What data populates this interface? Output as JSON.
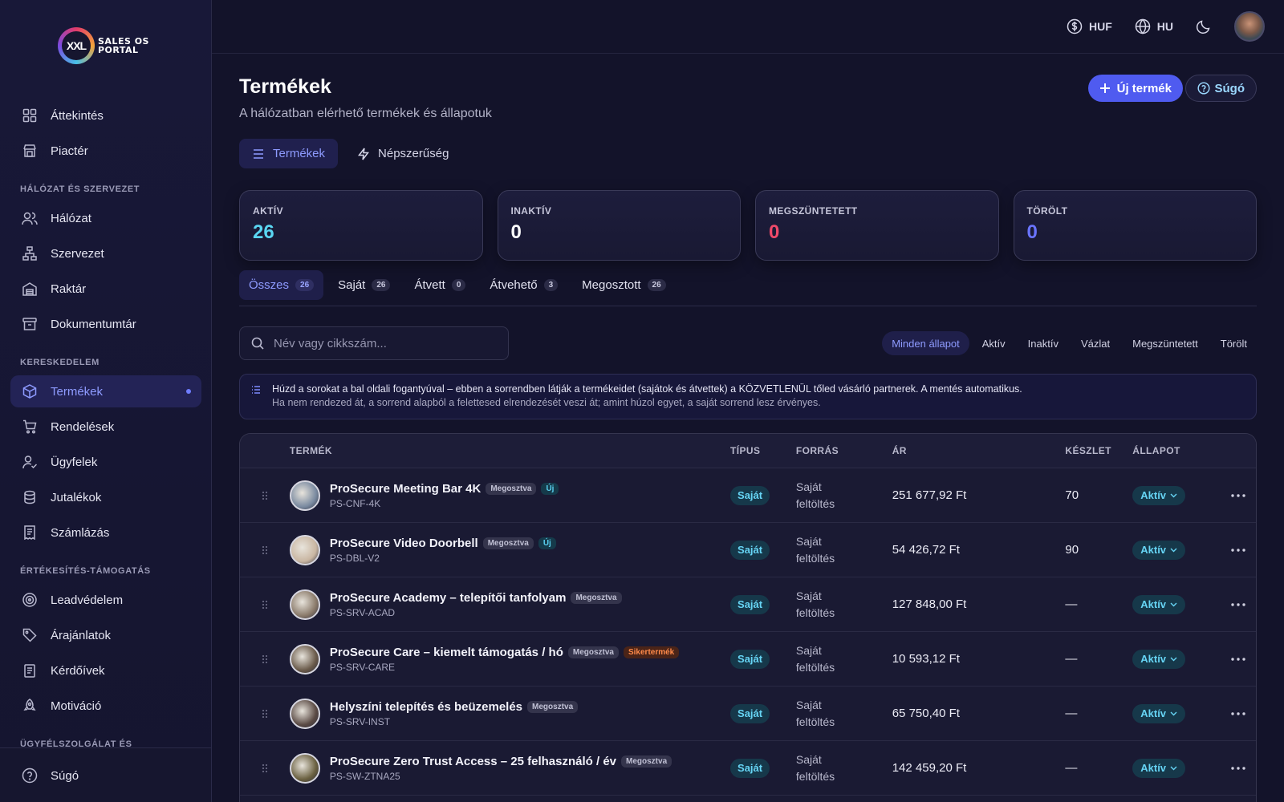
{
  "brand": {
    "logo_mark": "XXL",
    "logo_text_line1": "SALES OS",
    "logo_text_line2": "PORTAL"
  },
  "topbar": {
    "currency": "HUF",
    "language": "HU"
  },
  "sidebar": {
    "top_items": [
      {
        "label": "Áttekintés",
        "icon": "grid-icon"
      },
      {
        "label": "Piactér",
        "icon": "store-icon"
      }
    ],
    "section1": "HÁLÓZAT ÉS SZERVEZET",
    "section1_items": [
      {
        "label": "Hálózat",
        "icon": "users-icon"
      },
      {
        "label": "Szervezet",
        "icon": "org-chart-icon"
      },
      {
        "label": "Raktár",
        "icon": "warehouse-icon"
      },
      {
        "label": "Dokumentumtár",
        "icon": "archive-icon"
      }
    ],
    "section2": "KERESKEDELEM",
    "section2_items": [
      {
        "label": "Termékek",
        "icon": "box-icon",
        "active": true
      },
      {
        "label": "Rendelések",
        "icon": "cart-icon"
      },
      {
        "label": "Ügyfelek",
        "icon": "customer-icon"
      },
      {
        "label": "Jutalékok",
        "icon": "coins-icon"
      },
      {
        "label": "Számlázás",
        "icon": "receipt-icon"
      }
    ],
    "section3": "ÉRTÉKESÍTÉS-TÁMOGATÁS",
    "section3_items": [
      {
        "label": "Leadvédelem",
        "icon": "target-icon"
      },
      {
        "label": "Árajánlatok",
        "icon": "tag-icon"
      },
      {
        "label": "Kérdőívek",
        "icon": "clipboard-icon"
      },
      {
        "label": "Motiváció",
        "icon": "rocket-icon"
      }
    ],
    "section4": "ÜGYFÉLSZOLGÁLAT ÉS",
    "bottom_item": {
      "label": "Súgó",
      "icon": "help-circle-icon"
    }
  },
  "page": {
    "title": "Termékek",
    "subtitle": "A hálózatban elérhető termékek és állapotuk",
    "new_button": "Új termék",
    "help_button": "Súgó"
  },
  "view_tabs": [
    {
      "label": "Termékek",
      "active": true
    },
    {
      "label": "Népszerűség",
      "active": false
    }
  ],
  "stats": [
    {
      "label": "AKTÍV",
      "value": "26",
      "color": "#5ad6f2"
    },
    {
      "label": "INAKTÍV",
      "value": "0",
      "color": "#ffffff"
    },
    {
      "label": "MEGSZÜNTETETT",
      "value": "0",
      "color": "#f04a6a"
    },
    {
      "label": "TÖRÖLT",
      "value": "0",
      "color": "#6a74ff"
    }
  ],
  "filter_tabs": [
    {
      "label": "Összes",
      "count": "26",
      "active": true
    },
    {
      "label": "Saját",
      "count": "26",
      "active": false
    },
    {
      "label": "Átvett",
      "count": "0",
      "active": false
    },
    {
      "label": "Átvehető",
      "count": "3",
      "active": false
    },
    {
      "label": "Megosztott",
      "count": "26",
      "active": false
    }
  ],
  "search": {
    "placeholder": "Név vagy cikkszám..."
  },
  "state_filters": [
    {
      "label": "Minden állapot",
      "active": true
    },
    {
      "label": "Aktív",
      "active": false
    },
    {
      "label": "Inaktív",
      "active": false
    },
    {
      "label": "Vázlat",
      "active": false
    },
    {
      "label": "Megszüntetett",
      "active": false
    },
    {
      "label": "Törölt",
      "active": false
    }
  ],
  "info": {
    "line1": "Húzd a sorokat a bal oldali fogantyúval – ebben a sorrendben látják a termékeidet (sajátok és átvettek) a KÖZVETLENÜL tőled vásárló partnerek. A mentés automatikus.",
    "line2": "Ha nem rendezed át, a sorrend alapból a felettesed elrendezését veszi át; amint húzol egyet, a saját sorrend lesz érvényes."
  },
  "table": {
    "headers": {
      "product": "TERMÉK",
      "type": "TÍPUS",
      "source": "FORRÁS",
      "price": "ÁR",
      "stock": "KÉSZLET",
      "state": "ÁLLAPOT"
    },
    "rows": [
      {
        "name": "ProSecure Meeting Bar 4K",
        "sku": "PS-CNF-4K",
        "tags": [
          {
            "text": "Megosztva",
            "kind": "shared"
          },
          {
            "text": "Új",
            "kind": "new"
          }
        ],
        "type": "Saját",
        "source_line1": "Saját",
        "source_line2": "feltöltés",
        "price": "251 677,92 Ft",
        "stock": "70",
        "state": "Aktív",
        "thumb_color": "#7a8aa0"
      },
      {
        "name": "ProSecure Video Doorbell",
        "sku": "PS-DBL-V2",
        "tags": [
          {
            "text": "Megosztva",
            "kind": "shared"
          },
          {
            "text": "Új",
            "kind": "new"
          }
        ],
        "type": "Saját",
        "source_line1": "Saját",
        "source_line2": "feltöltés",
        "price": "54 426,72 Ft",
        "stock": "90",
        "state": "Aktív",
        "thumb_color": "#c9b6a2"
      },
      {
        "name": "ProSecure Academy – telepítői tanfolyam",
        "sku": "PS-SRV-ACAD",
        "tags": [
          {
            "text": "Megosztva",
            "kind": "shared"
          }
        ],
        "type": "Saját",
        "source_line1": "Saját",
        "source_line2": "feltöltés",
        "price": "127 848,00 Ft",
        "stock": "—",
        "state": "Aktív",
        "thumb_color": "#8a7a6a"
      },
      {
        "name": "ProSecure Care – kiemelt támogatás / hó",
        "sku": "PS-SRV-CARE",
        "tags": [
          {
            "text": "Megosztva",
            "kind": "shared"
          },
          {
            "text": "Sikertermék",
            "kind": "best"
          }
        ],
        "type": "Saját",
        "source_line1": "Saját",
        "source_line2": "feltöltés",
        "price": "10 593,12 Ft",
        "stock": "—",
        "state": "Aktív",
        "thumb_color": "#6a5a4a"
      },
      {
        "name": "Helyszíni telepítés és beüzemelés",
        "sku": "PS-SRV-INST",
        "tags": [
          {
            "text": "Megosztva",
            "kind": "shared"
          }
        ],
        "type": "Saját",
        "source_line1": "Saját",
        "source_line2": "feltöltés",
        "price": "65 750,40 Ft",
        "stock": "—",
        "state": "Aktív",
        "thumb_color": "#5a4a44"
      },
      {
        "name": "ProSecure Zero Trust Access – 25 felhasználó / év",
        "sku": "PS-SW-ZTNA25",
        "tags": [
          {
            "text": "Megosztva",
            "kind": "shared"
          }
        ],
        "type": "Saját",
        "source_line1": "Saját",
        "source_line2": "feltöltés",
        "price": "142 459,20 Ft",
        "stock": "—",
        "state": "Aktív",
        "thumb_color": "#6a6040"
      }
    ]
  }
}
